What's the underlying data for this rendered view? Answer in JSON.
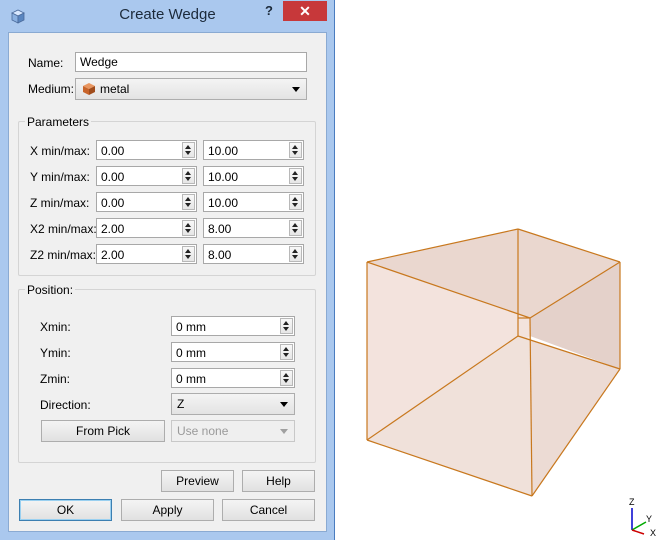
{
  "dialog": {
    "title": "Create Wedge",
    "help_label": "?",
    "close_label": "✕"
  },
  "fields": {
    "name_label": "Name:",
    "name_value": "Wedge",
    "medium_label": "Medium:",
    "medium_value": "metal",
    "medium_icon": "material-cube-icon"
  },
  "parameters": {
    "title": "Parameters",
    "rows": [
      {
        "label": "X min/max:",
        "min": "0.00",
        "max": "10.00"
      },
      {
        "label": "Y min/max:",
        "min": "0.00",
        "max": "10.00"
      },
      {
        "label": "Z min/max:",
        "min": "0.00",
        "max": "10.00"
      },
      {
        "label": "X2 min/max:",
        "min": "2.00",
        "max": "8.00"
      },
      {
        "label": "Z2 min/max:",
        "min": "2.00",
        "max": "8.00"
      }
    ]
  },
  "position": {
    "title": "Position:",
    "xmin_label": "Xmin:",
    "xmin_value": "0 mm",
    "ymin_label": "Ymin:",
    "ymin_value": "0 mm",
    "zmin_label": "Zmin:",
    "zmin_value": "0 mm",
    "direction_label": "Direction:",
    "direction_value": "Z",
    "from_pick_label": "From Pick",
    "use_value": "Use none"
  },
  "buttons": {
    "preview": "Preview",
    "help": "Help",
    "ok": "OK",
    "apply": "Apply",
    "cancel": "Cancel"
  },
  "viewport": {
    "axes": {
      "z": "Z",
      "y": "Y",
      "x": "X"
    }
  },
  "colors": {
    "titlebar": "#aac8ee",
    "close_button": "#c7383a",
    "wedge_fill": "#f0ddd5",
    "wedge_edge": "#c8781e",
    "material_icon": "#c8642a",
    "axis_x": "#cc0000",
    "axis_y": "#00aa00",
    "axis_z": "#0000cc"
  }
}
